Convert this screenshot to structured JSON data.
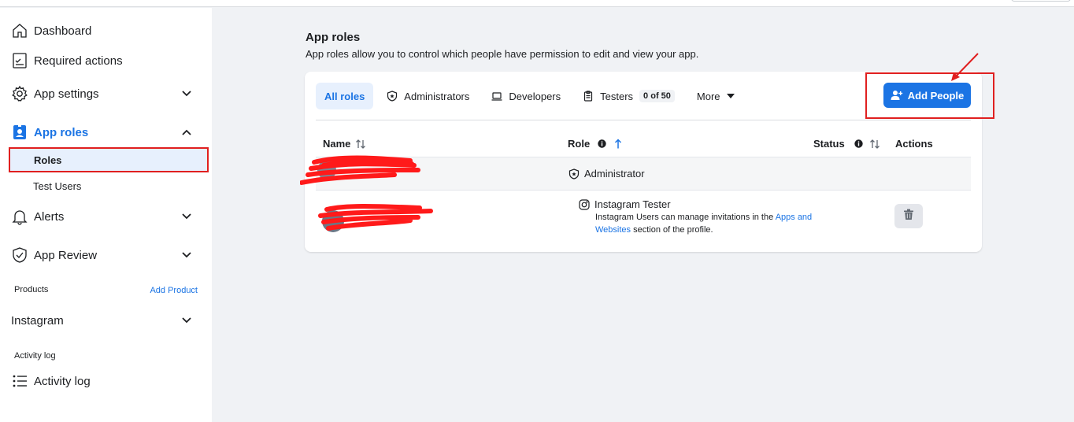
{
  "sidebar": {
    "items": [
      {
        "label": "Dashboard",
        "icon": "house-icon"
      },
      {
        "label": "Required actions",
        "icon": "checklist-icon"
      },
      {
        "label": "App settings",
        "icon": "gear-icon"
      },
      {
        "label": "App roles",
        "icon": "id-badge-icon"
      },
      {
        "label": "Alerts",
        "icon": "bell-icon"
      },
      {
        "label": "App Review",
        "icon": "shield-check-icon"
      },
      {
        "label": "Instagram"
      },
      {
        "label": "Activity log",
        "icon": "list-icon"
      }
    ],
    "sub_items": [
      {
        "label": "Roles"
      },
      {
        "label": "Test Users"
      }
    ],
    "products_label": "Products",
    "add_product_label": "Add Product",
    "activity_section_label": "Activity log"
  },
  "main": {
    "title": "App roles",
    "description": "App roles allow you to control which people have permission to edit and view your app.",
    "tabs": [
      {
        "label": "All roles"
      },
      {
        "label": "Administrators",
        "icon": "shield-star-icon"
      },
      {
        "label": "Developers",
        "icon": "laptop-icon"
      },
      {
        "label": "Testers",
        "icon": "clipboard-icon",
        "badge": "0 of 50"
      },
      {
        "label": "More"
      }
    ],
    "add_button_label": "Add People",
    "table": {
      "headers": [
        "Name",
        "Role",
        "Status",
        "Actions"
      ],
      "rows": [
        {
          "role": "Administrator",
          "role_icon": "shield-star-icon"
        },
        {
          "role": "Instagram Tester",
          "role_icon": "instagram-icon",
          "desc_before": "Instagram Users can manage invitations in the ",
          "desc_link": "Apps and Websites",
          "desc_after": " section of the profile."
        }
      ]
    }
  },
  "colors": {
    "accent": "#1b74e4",
    "highlight_red": "#e02020",
    "background": "#f0f2f5"
  }
}
